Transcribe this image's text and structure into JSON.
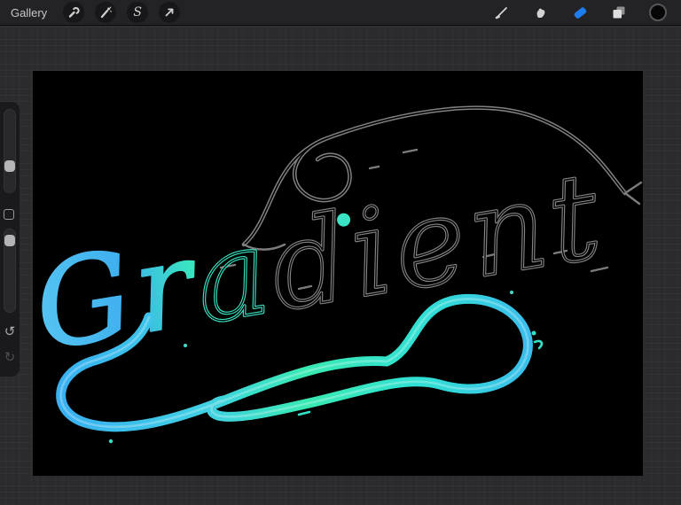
{
  "topbar": {
    "gallery_label": "Gallery",
    "left_tools": [
      {
        "label": "Actions",
        "icon": "wrench-icon"
      },
      {
        "label": "Adjustments",
        "icon": "magic-wand-icon",
        "glyph": ""
      },
      {
        "label": "Selection",
        "icon": "selection-s-icon",
        "glyph": "S"
      },
      {
        "label": "Transform",
        "icon": "transform-arrow-icon"
      }
    ],
    "right_tools": [
      {
        "label": "Paint",
        "icon": "brush-icon",
        "active": false
      },
      {
        "label": "Smudge",
        "icon": "smudge-icon",
        "active": false
      },
      {
        "label": "Erase",
        "icon": "eraser-icon",
        "active": true
      },
      {
        "label": "Layers",
        "icon": "layers-icon",
        "active": false
      },
      {
        "label": "Color",
        "icon": "color-circle-icon",
        "active": false,
        "current_color": "#060607"
      }
    ],
    "accent_color": "#1b7df0"
  },
  "sidebar": {
    "brush_size_slider": {
      "fraction_from_top": 0.64
    },
    "opacity_slider": {
      "fraction_from_top": 0.07
    },
    "modify_button": {
      "icon": "square-icon"
    },
    "undo_button": {
      "icon": "undo-arrow-icon",
      "glyph": "↺"
    },
    "redo_button": {
      "icon": "redo-arrow-icon",
      "glyph": "↻",
      "enabled": false
    }
  },
  "canvas": {
    "background_color": "#000000",
    "artwork": {
      "word": "Gradient",
      "segment_filled": "Gr",
      "segment_teal_outline": "a",
      "segment_sketch": "dient",
      "style": "script lettering with flourishes; left part painted blue-to-teal gradient, rest gray sketch outline",
      "colors": {
        "blue": "#41b6f0",
        "teal": "#3ce9b8",
        "sketch_gray": "#808080"
      }
    }
  }
}
